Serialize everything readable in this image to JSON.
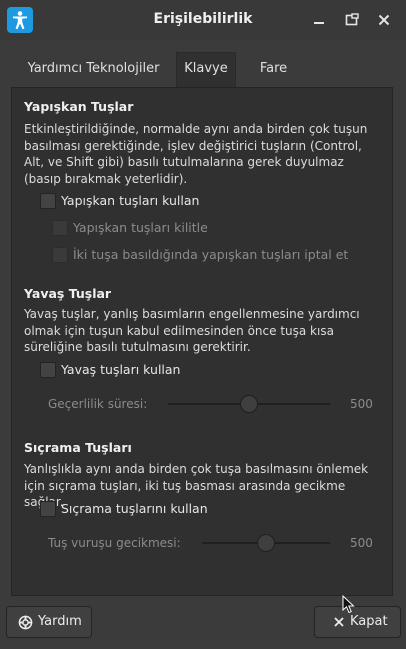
{
  "window": {
    "title": "Erişilebilirlik"
  },
  "tabs": [
    {
      "label": "Yardımcı Teknolojiler",
      "active": false
    },
    {
      "label": "Klavye",
      "active": true
    },
    {
      "label": "Fare",
      "active": false
    }
  ],
  "sticky": {
    "title": "Yapışkan Tuşlar",
    "description": "Etkinleştirildiğinde, normalde aynı anda birden çok tuşun basılması gerektiğinde, işlev değiştirici tuşların (Control, Alt, ve Shift gibi) basılı tutulmalarına gerek duyulmaz (basıp bırakmak yeterlidir).",
    "enable_label": "Yapışkan tuşları kullan",
    "lock_label": "Yapışkan tuşları kilitle",
    "disable_two_label": "İki tuşa basıldığında yapışkan tuşları iptal et"
  },
  "slow": {
    "title": "Yavaş Tuşlar",
    "description": "Yavaş tuşlar, yanlış basımların engellenmesine yardımcı olmak için tuşun kabul edilmesinden önce tuşa kısa süreliğine basılı tutulmasını gerektirir.",
    "enable_label": "Yavaş tuşları kullan",
    "slider_label": "Geçerlilik süresi:",
    "slider_value": "500",
    "slider_fraction": 0.5
  },
  "bounce": {
    "title": "Sıçrama Tuşları",
    "description": "Yanlışlıkla aynı anda birden çok tuşa basılmasını önlemek için sıçrama tuşları, iki tuş basması arasında gecikme sağlar.",
    "enable_label": "Sıçrama tuşlarını kullan",
    "slider_label": "Tuş vuruşu gecikmesi:",
    "slider_value": "500",
    "slider_fraction": 0.5
  },
  "buttons": {
    "help_label": "Yardım",
    "close_label": "Kapat"
  },
  "colors": {
    "accent": "#2d7fd0",
    "app_icon": "#1e9be0",
    "background": "#3b3b3b",
    "panel": "#303030"
  }
}
